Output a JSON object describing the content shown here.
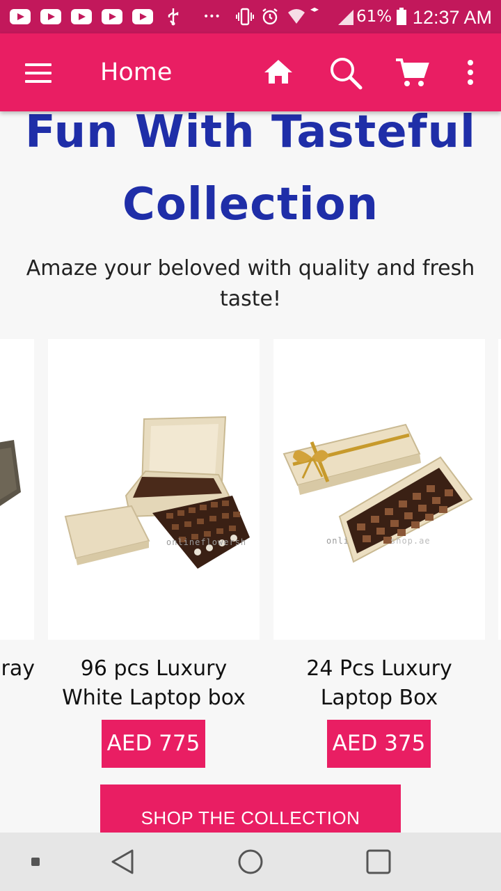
{
  "status_bar": {
    "battery": "61%",
    "time": "12:37 AM"
  },
  "app_bar": {
    "title": "Home",
    "icons": [
      "menu-icon",
      "home-icon",
      "search-icon",
      "cart-icon",
      "more-vert-icon"
    ]
  },
  "collection": {
    "headline_line1": "Fun With Tasteful",
    "headline_line2": "Collection",
    "subtitle": "Amaze your beloved with quality and fresh taste!",
    "products": [
      {
        "name_fragment": "ray"
      },
      {
        "name_line1": "96 pcs Luxury",
        "name_line2": "White Laptop box",
        "price": "AED 775"
      },
      {
        "name_line1": "24 Pcs Luxury",
        "name_line2": "Laptop Box",
        "price": "AED 375"
      }
    ],
    "shop_button": "SHOP THE COLLECTION"
  },
  "colors": {
    "status_bar": "#c2185b",
    "accent": "#e91e63",
    "headline": "#1f2ea8"
  }
}
